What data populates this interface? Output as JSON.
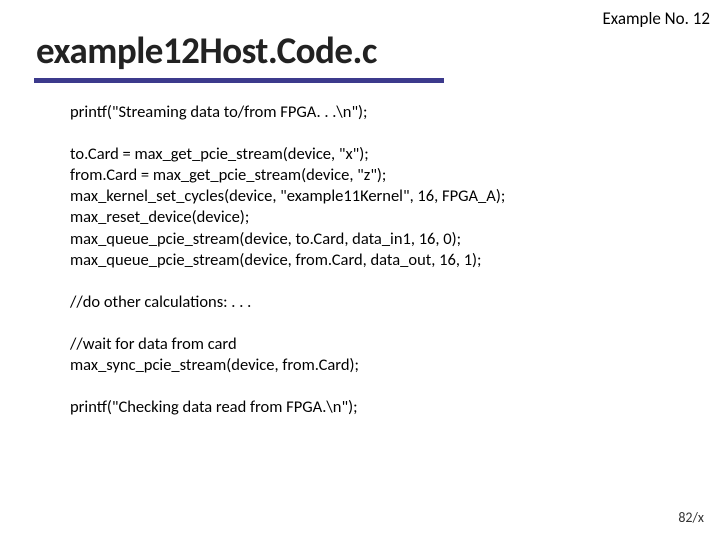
{
  "header": {
    "example_no": "Example No. 12"
  },
  "title": "example12Host.Code.c",
  "code": {
    "s1_l1": "printf(\"Streaming data to/from FPGA. . .\\n\");",
    "s2_l1": "to.Card = max_get_pcie_stream(device, \"x\");",
    "s2_l2": "from.Card = max_get_pcie_stream(device, \"z\");",
    "s2_l3": "max_kernel_set_cycles(device, \"example11Kernel\", 16, FPGA_A);",
    "s2_l4": "max_reset_device(device);",
    "s2_l5": "max_queue_pcie_stream(device, to.Card, data_in1, 16, 0);",
    "s2_l6": "max_queue_pcie_stream(device, from.Card, data_out, 16, 1);",
    "s3_l1": "//do other calculations: . . .",
    "s4_l1": "//wait for data from card",
    "s4_l2": "max_sync_pcie_stream(device, from.Card);",
    "s5_l1": "printf(\"Checking data read from FPGA.\\n\");"
  },
  "footer": {
    "page": "82/x"
  }
}
